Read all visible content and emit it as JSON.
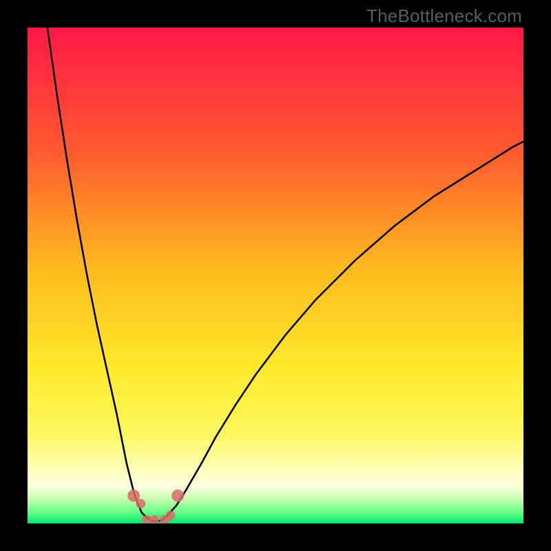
{
  "watermark": "TheBottleneck.com",
  "colors": {
    "frame": "#000000",
    "grad_top": "#ff1848",
    "grad_mid1": "#ff6a2a",
    "grad_mid2": "#ffd21a",
    "grad_mid3": "#fff855",
    "grad_pale": "#fdffc7",
    "grad_lime": "#9cff60",
    "grad_green": "#00e56c",
    "curve": "#000000",
    "dot": "#d86a6a"
  },
  "chart_data": {
    "type": "line",
    "title": "",
    "xlabel": "",
    "ylabel": "",
    "xlim": [
      0,
      100
    ],
    "ylim": [
      0,
      100
    ],
    "series": [
      {
        "name": "bottleneck-curve-left",
        "x": [
          4,
          6,
          8,
          10,
          12,
          14,
          16,
          18,
          20,
          21.5,
          23,
          24,
          25,
          26
        ],
        "values": [
          100,
          86,
          73,
          61,
          50,
          40,
          31,
          22,
          12,
          6,
          2.2,
          1.2,
          0.6,
          0.4
        ]
      },
      {
        "name": "bottleneck-curve-right",
        "x": [
          26,
          27,
          28,
          30,
          32,
          35,
          38,
          42,
          46,
          52,
          58,
          66,
          74,
          82,
          90,
          98,
          100
        ],
        "values": [
          0.4,
          0.6,
          1.4,
          3.6,
          6.8,
          12,
          17.5,
          24,
          30,
          38,
          45,
          53,
          60,
          66,
          71,
          76,
          77
        ]
      }
    ],
    "dots": {
      "name": "optimal-markers",
      "x": [
        21.4,
        22.8,
        24.0,
        25.6,
        27.6,
        28.8,
        30.3
      ],
      "values": [
        5.6,
        4.0,
        0.7,
        0.7,
        0.7,
        1.6,
        5.6
      ]
    }
  }
}
